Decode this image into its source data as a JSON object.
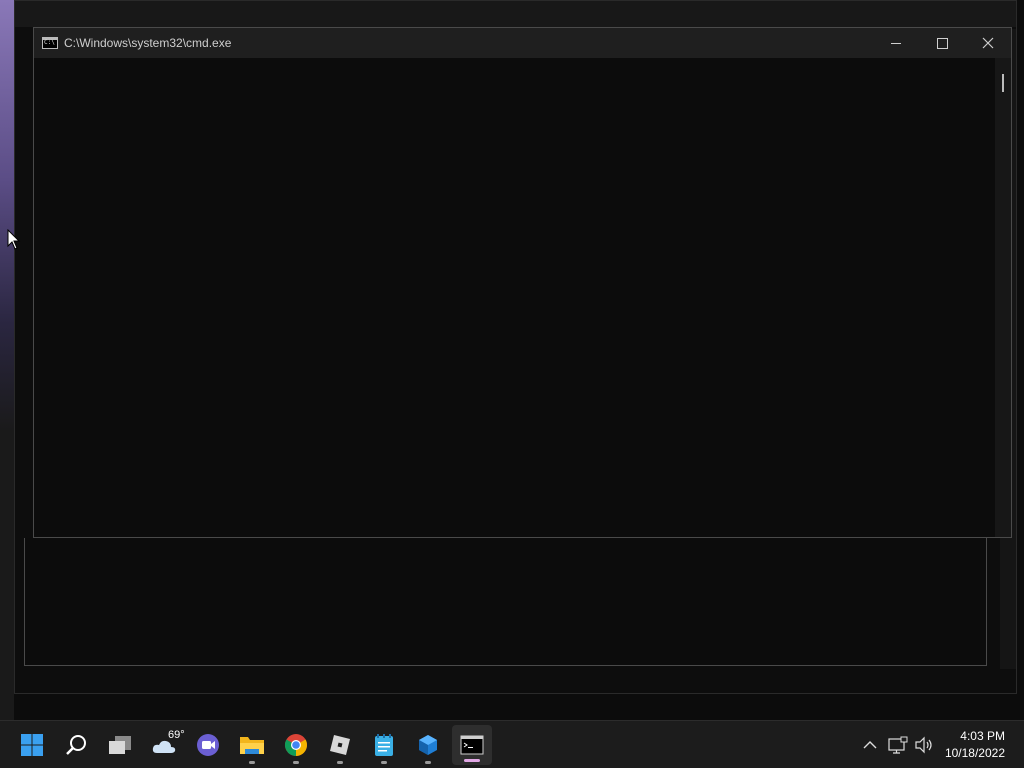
{
  "window": {
    "title": "C:\\Windows\\system32\\cmd.exe",
    "minimize_label": "Minimize",
    "maximize_label": "Maximize",
    "close_label": "Close"
  },
  "taskbar": {
    "items": [
      {
        "name": "start-button",
        "icon": "windows-logo-icon"
      },
      {
        "name": "search-button",
        "icon": "search-icon"
      },
      {
        "name": "task-view-button",
        "icon": "task-view-icon"
      },
      {
        "name": "widgets-button",
        "icon": "weather-cloud-icon",
        "label": "69°"
      },
      {
        "name": "chat-button",
        "icon": "teams-chat-icon"
      },
      {
        "name": "file-explorer-button",
        "icon": "folder-icon"
      },
      {
        "name": "chrome-button",
        "icon": "chrome-icon"
      },
      {
        "name": "roblox-button",
        "icon": "roblox-icon"
      },
      {
        "name": "notepad-button",
        "icon": "notepad-icon"
      },
      {
        "name": "app-cube-button",
        "icon": "cube-app-icon"
      },
      {
        "name": "cmd-button",
        "icon": "terminal-icon",
        "active": true
      }
    ],
    "weather_temp": "69°",
    "clock_time": "4:03 PM",
    "clock_date": "10/18/2022"
  },
  "colors": {
    "accent_active": "#e2a8e6",
    "windows_blue": "#3aa0f0",
    "console_bg": "#0c0c0c"
  }
}
